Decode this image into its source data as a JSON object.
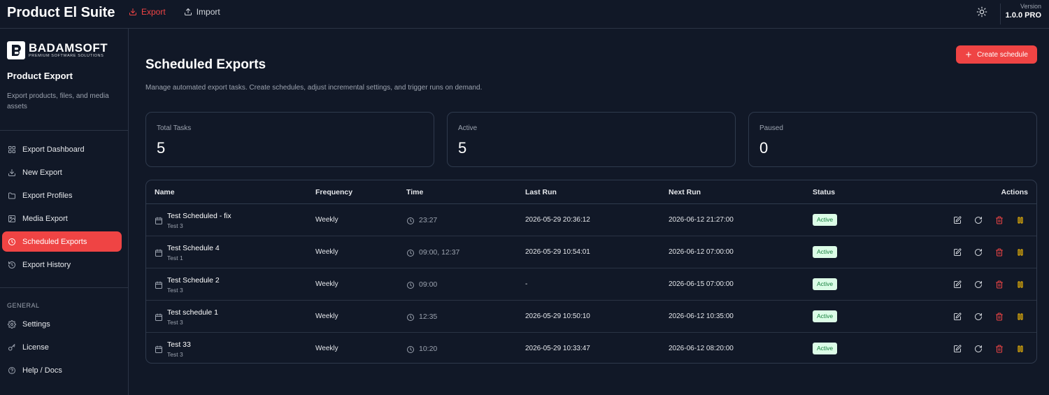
{
  "header": {
    "app_title": "Product El Suite",
    "nav": [
      {
        "label": "Export",
        "icon": "download-icon",
        "active": true
      },
      {
        "label": "Import",
        "icon": "upload-icon",
        "active": false
      }
    ],
    "version_label": "Version",
    "version_value": "1.0.0 PRO"
  },
  "sidebar": {
    "logo_name": "BADAMSOFT",
    "logo_tagline": "PREMIUM SOFTWARE SOLUTIONS",
    "title": "Product Export",
    "description": "Export products, files, and media assets",
    "items": [
      {
        "label": "Export Dashboard",
        "icon": "grid-icon"
      },
      {
        "label": "New Export",
        "icon": "download-icon"
      },
      {
        "label": "Export Profiles",
        "icon": "folder-icon"
      },
      {
        "label": "Media Export",
        "icon": "image-icon"
      },
      {
        "label": "Scheduled Exports",
        "icon": "clock-icon",
        "active": true
      },
      {
        "label": "Export History",
        "icon": "history-icon"
      }
    ],
    "general_heading": "GENERAL",
    "general_items": [
      {
        "label": "Settings",
        "icon": "gear-icon"
      },
      {
        "label": "License",
        "icon": "key-icon"
      },
      {
        "label": "Help / Docs",
        "icon": "help-icon"
      }
    ]
  },
  "main": {
    "title": "Scheduled Exports",
    "subtitle": "Manage automated export tasks. Create schedules, adjust incremental settings, and trigger runs on demand.",
    "create_button": "Create schedule",
    "stats": [
      {
        "label": "Total Tasks",
        "value": "5"
      },
      {
        "label": "Active",
        "value": "5"
      },
      {
        "label": "Paused",
        "value": "0"
      }
    ],
    "table": {
      "columns": [
        "Name",
        "Frequency",
        "Time",
        "Last Run",
        "Next Run",
        "Status",
        "Actions"
      ],
      "rows": [
        {
          "name": "Test Scheduled - fix",
          "profile": "Test 3",
          "frequency": "Weekly",
          "time": "23:27",
          "last_run": "2026-05-29 20:36:12",
          "next_run": "2026-06-12 21:27:00",
          "status": "Active"
        },
        {
          "name": "Test Schedule 4",
          "profile": "Test 1",
          "frequency": "Weekly",
          "time": "09:00, 12:37",
          "last_run": "2026-05-29 10:54:01",
          "next_run": "2026-06-12 07:00:00",
          "status": "Active"
        },
        {
          "name": "Test Schedule 2",
          "profile": "Test 3",
          "frequency": "Weekly",
          "time": "09:00",
          "last_run": "-",
          "next_run": "2026-06-15 07:00:00",
          "status": "Active"
        },
        {
          "name": "Test schedule 1",
          "profile": "Test 3",
          "frequency": "Weekly",
          "time": "12:35",
          "last_run": "2026-05-29 10:50:10",
          "next_run": "2026-06-12 10:35:00",
          "status": "Active"
        },
        {
          "name": "Test 33",
          "profile": "Test 3",
          "frequency": "Weekly",
          "time": "10:20",
          "last_run": "2026-05-29 10:33:47",
          "next_run": "2026-06-12 08:20:00",
          "status": "Active"
        }
      ],
      "row_actions": [
        {
          "icon": "edit-icon",
          "color": "#d1d5db"
        },
        {
          "icon": "refresh-icon",
          "color": "#d1d5db"
        },
        {
          "icon": "trash-icon",
          "color": "#ef4444"
        },
        {
          "icon": "pause-icon",
          "color": "#eab308"
        }
      ]
    }
  },
  "colors": {
    "accent": "#ef4444",
    "background": "#111827",
    "status_active_bg": "#dcfce7",
    "status_active_text": "#15803d",
    "pause": "#eab308"
  }
}
